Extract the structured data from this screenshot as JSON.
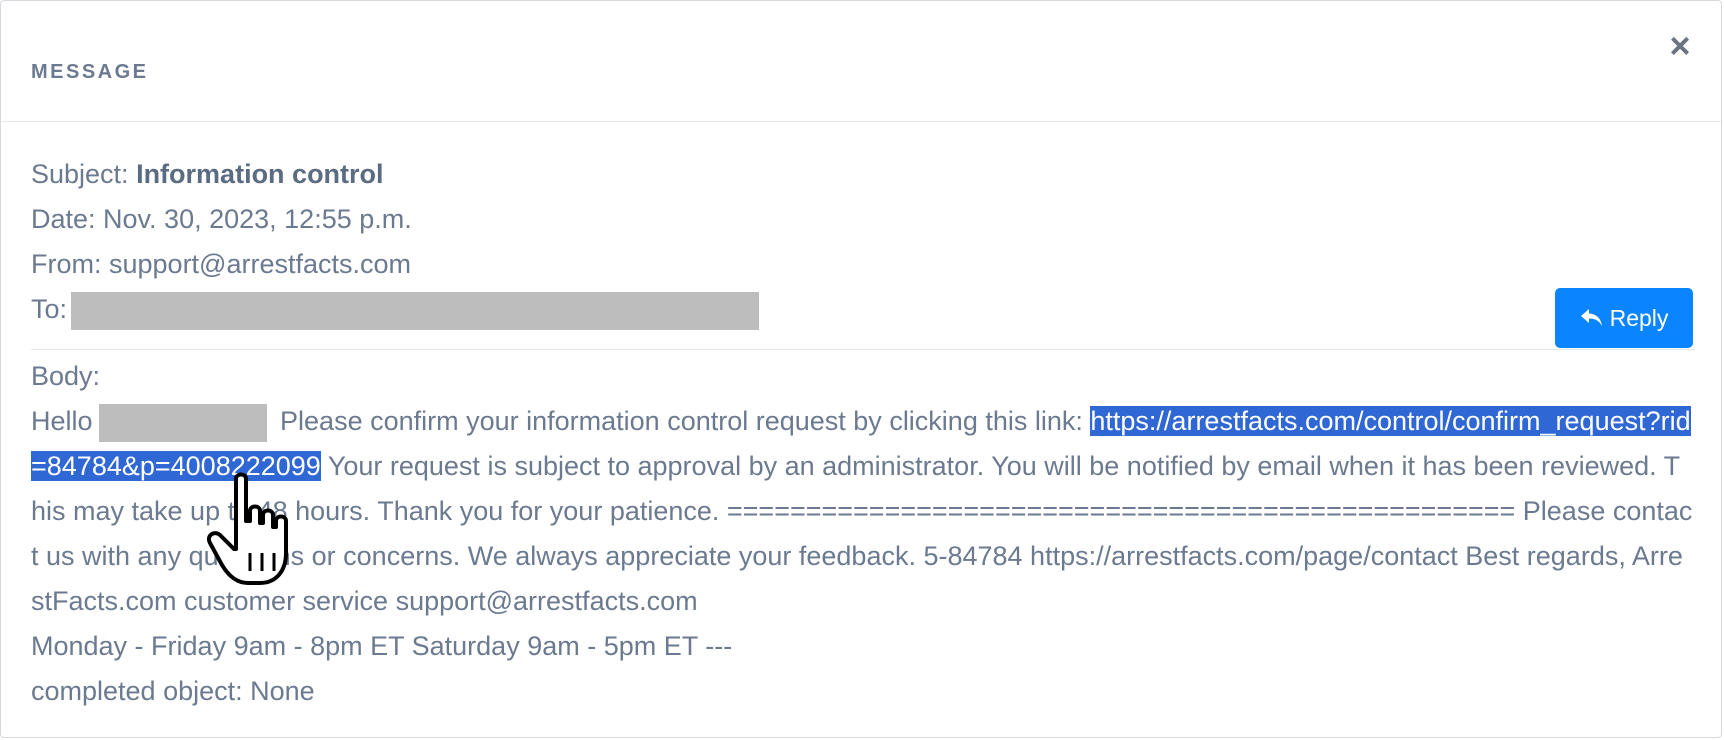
{
  "header": {
    "title": "MESSAGE",
    "close_glyph": "×"
  },
  "meta": {
    "subject_label": "Subject: ",
    "subject_value": "Information control",
    "date_label": "Date: ",
    "date_value": "Nov. 30, 2023, 12:55 p.m.",
    "from_label": "From: ",
    "from_value": "support@arrestfacts.com",
    "to_label": "To:"
  },
  "reply_button": {
    "label": "Reply",
    "icon": "reply-icon",
    "color": "#0a84ff"
  },
  "body": {
    "label": "Body:",
    "greeting": "Hello",
    "intro": " Please confirm your information control request by clicking this link: ",
    "link": "https://arrestfacts.com/control/confirm_request?rid=84784&p=4008222099",
    "rest": " Your request is subject to approval by an administrator. You will be notified by email when it has been reviewed. This may take up to 48 hours. Thank you for your patience. ================================================== Please contact us with any questions or concerns. We always appreciate your feedback. 5-84784 https://arrestfacts.com/page/contact Best regards, ArrestFacts.com customer service support@arrestfacts.com",
    "hours": "Monday - Friday 9am - 8pm ET Saturday 9am - 5pm ET ---",
    "completed": "completed object: None"
  },
  "colors": {
    "text": "#6b7a90",
    "selection": "#2f67d4",
    "redaction": "#bdbdbd"
  }
}
